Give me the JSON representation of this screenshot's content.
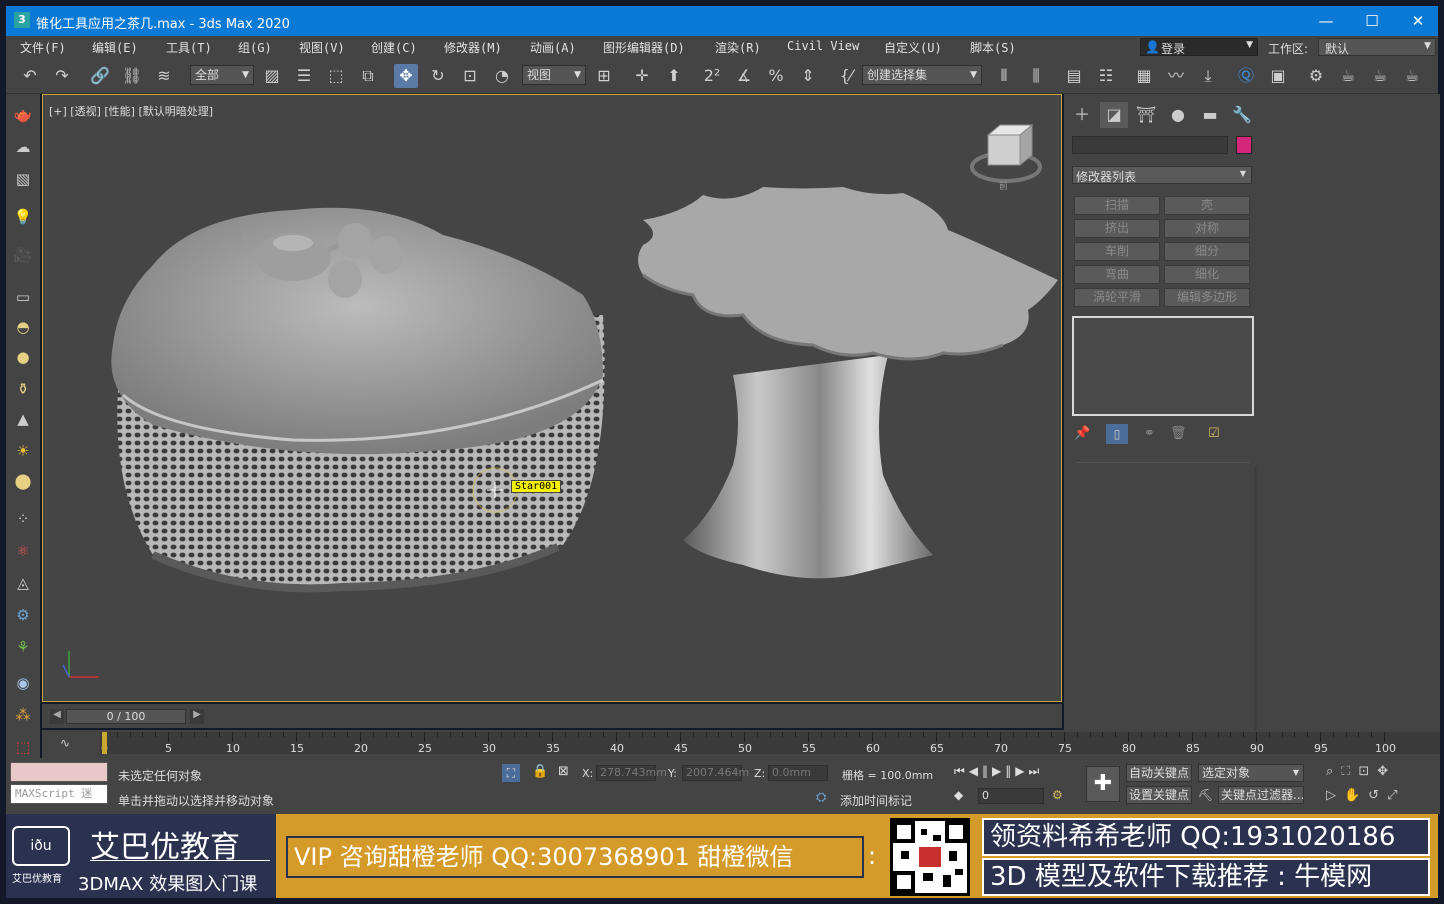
{
  "window": {
    "title": "锥化工具应用之茶几.max - 3ds Max 2020",
    "app_icon": "3",
    "minimize": "—",
    "maximize": "☐",
    "close": "✕"
  },
  "menu": [
    "文件(F)",
    "编辑(E)",
    "工具(T)",
    "组(G)",
    "视图(V)",
    "创建(C)",
    "修改器(M)",
    "动画(A)",
    "图形编辑器(D)",
    "渲染(R)",
    "Civil View",
    "自定义(U)",
    "脚本(S)"
  ],
  "account": {
    "login": "登录",
    "workspace_label": "工作区:",
    "workspace_value": "默认"
  },
  "toolbar": {
    "filter": "全部",
    "ref_coord": "视图",
    "selection_set": "创建选择集"
  },
  "viewport": {
    "label": "[+] [透视] [性能] [默认明暗处理]",
    "tooltip": "Star001",
    "viewcube_face": "前"
  },
  "command_panel": {
    "modifier_list": "修改器列表",
    "buttons": [
      "扫描",
      "壳",
      "挤出",
      "对称",
      "车削",
      "细分",
      "弯曲",
      "细化",
      "涡轮平滑",
      "编辑多边形"
    ],
    "swatch_color": "#d4267a"
  },
  "timeline": {
    "frame": "0 / 100",
    "ticks": [
      "0",
      "5",
      "10",
      "15",
      "20",
      "25",
      "30",
      "35",
      "40",
      "45",
      "50",
      "55",
      "60",
      "65",
      "70",
      "75",
      "80",
      "85",
      "90",
      "95",
      "100"
    ]
  },
  "status": {
    "selection": "未选定任何对象",
    "hint": "单击并拖动以选择并移动对象",
    "maxscript": "MAXScript 迷",
    "x_label": "X:",
    "x_value": "278.743mm",
    "y_label": "Y:",
    "y_value": "2007.464m",
    "z_label": "Z:",
    "z_value": "0.0mm",
    "grid": "栅格 = 100.0mm",
    "add_time_tag": "添加时间标记",
    "auto_key": "自动关键点",
    "set_key": "设置关键点",
    "selected_object": "选定对象",
    "key_filter": "关键点过滤器...",
    "frame_input": "0"
  },
  "ad": {
    "brand": "艾巴优教育",
    "brand_sub": "3DMAX 效果图入门课",
    "logo_text": "艾巴优教育",
    "vip": "VIP 咨询甜橙老师 QQ:3007368901  甜橙微信",
    "right1": "领资料希希老师 QQ:1931020186",
    "right2": "3D 模型及软件下载推荐 : 牛模网"
  }
}
